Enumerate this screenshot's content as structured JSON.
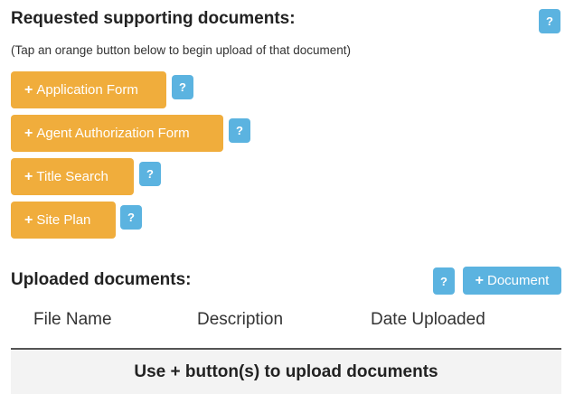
{
  "requested": {
    "heading": "Requested supporting documents:",
    "help_label": "?",
    "subtitle": "(Tap an orange button below to begin upload of that document)",
    "documents": [
      {
        "label": "Application Form",
        "help": "?"
      },
      {
        "label": "Agent Authorization Form",
        "help": "?"
      },
      {
        "label": "Title Search",
        "help": "?"
      },
      {
        "label": "Site Plan",
        "help": "?"
      }
    ]
  },
  "uploaded": {
    "heading": "Uploaded documents:",
    "help_label": "?",
    "add_button_label": "Document",
    "columns": [
      "File Name",
      "Description",
      "Date Uploaded"
    ],
    "empty_message": "Use + button(s) to upload documents"
  },
  "colors": {
    "orange": "#f0ad3c",
    "blue": "#5bb3e0"
  },
  "icons": {
    "plus": "+"
  }
}
